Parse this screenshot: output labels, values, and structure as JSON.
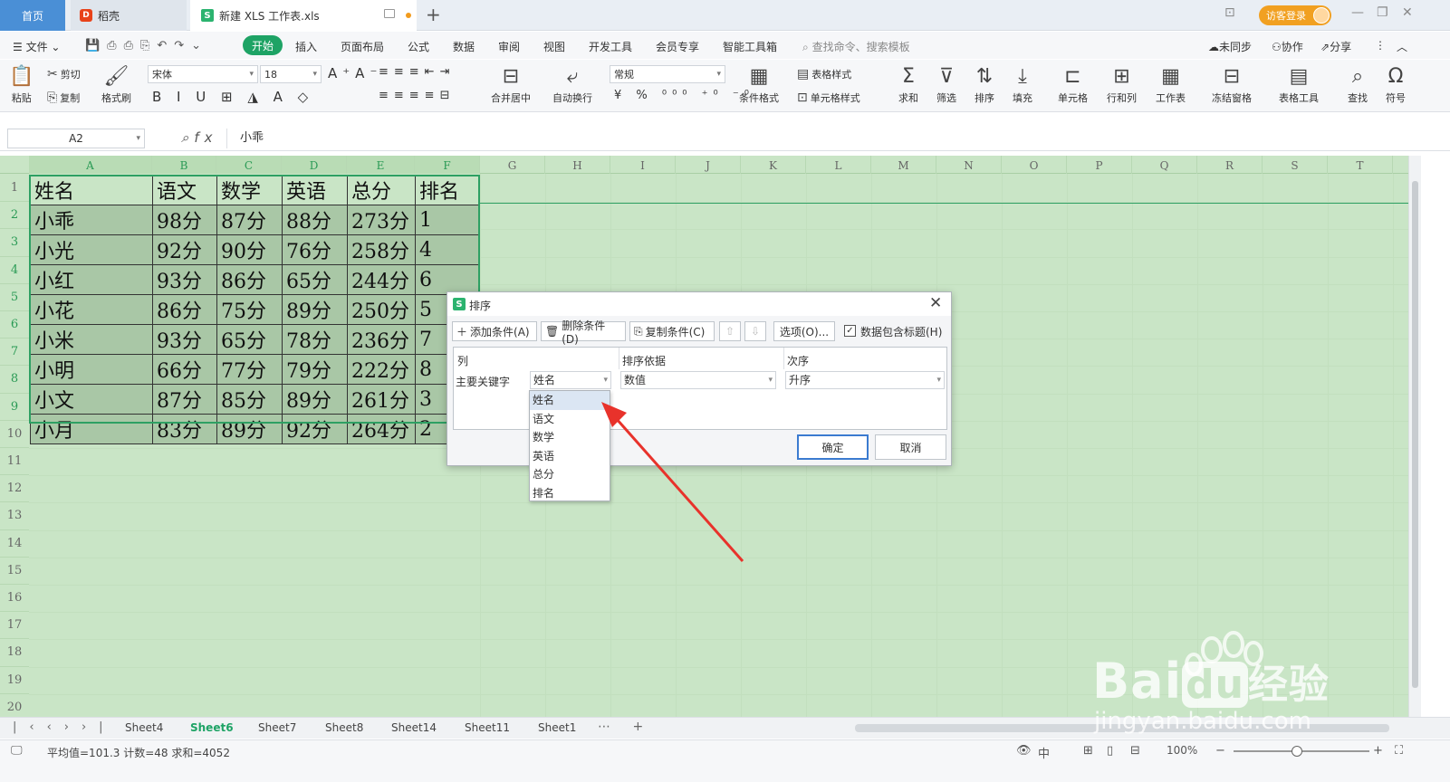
{
  "titlebar": {
    "tabs": [
      {
        "label": "首页"
      },
      {
        "label": "稻壳"
      },
      {
        "label": "新建 XLS 工作表.xls"
      }
    ],
    "visitor_label": "访客登录"
  },
  "menubar": {
    "file_label": "文件",
    "items": [
      "开始",
      "插入",
      "页面布局",
      "公式",
      "数据",
      "审阅",
      "视图",
      "开发工具",
      "会员专享",
      "智能工具箱"
    ],
    "search_placeholder": "查找命令、搜索模板",
    "sync_label": "未同步",
    "collab_label": "协作",
    "share_label": "分享"
  },
  "ribbon": {
    "paste": "粘贴",
    "cut": "剪切",
    "copy": "复制",
    "format_painter": "格式刷",
    "font_name": "宋体",
    "font_size": "18",
    "merge_center": "合并居中",
    "wrap_text": "自动换行",
    "number_format": "常规",
    "cond_format": "条件格式",
    "table_style": "表格样式",
    "cell_style": "单元格样式",
    "sum": "求和",
    "filter": "筛选",
    "sort": "排序",
    "fill": "填充",
    "cells": "单元格",
    "rows_cols": "行和列",
    "worksheet": "工作表",
    "freeze": "冻结窗格",
    "table_tools": "表格工具",
    "find": "查找",
    "symbol": "符号"
  },
  "formula": {
    "cell_ref": "A2",
    "fx": "fx",
    "value": "小乖"
  },
  "sheet": {
    "columns": [
      "A",
      "B",
      "C",
      "D",
      "E",
      "F",
      "G",
      "H",
      "I",
      "J",
      "K",
      "L",
      "M",
      "N",
      "O",
      "P",
      "Q",
      "R",
      "S",
      "T"
    ],
    "rows": [
      "1",
      "2",
      "3",
      "4",
      "5",
      "6",
      "7",
      "8",
      "9",
      "10",
      "11",
      "12",
      "13",
      "14",
      "15",
      "16",
      "17",
      "18",
      "19",
      "20"
    ],
    "header": [
      "姓名",
      "语文",
      "数学",
      "英语",
      "总分",
      "排名"
    ],
    "data": [
      [
        "小乖",
        "98分",
        "87分",
        "88分",
        "273分",
        "1"
      ],
      [
        "小光",
        "92分",
        "90分",
        "76分",
        "258分",
        "4"
      ],
      [
        "小红",
        "93分",
        "86分",
        "65分",
        "244分",
        "6"
      ],
      [
        "小花",
        "86分",
        "75分",
        "89分",
        "250分",
        "5"
      ],
      [
        "小米",
        "93分",
        "65分",
        "78分",
        "236分",
        "7"
      ],
      [
        "小明",
        "66分",
        "77分",
        "79分",
        "222分",
        "8"
      ],
      [
        "小文",
        "87分",
        "85分",
        "89分",
        "261分",
        "3"
      ],
      [
        "小月",
        "83分",
        "89分",
        "92分",
        "264分",
        "2"
      ]
    ]
  },
  "sheettabs": {
    "tabs": [
      "Sheet4",
      "Sheet6",
      "Sheet7",
      "Sheet8",
      "Sheet14",
      "Sheet11",
      "Sheet1"
    ],
    "active": "Sheet6"
  },
  "status": {
    "summary": "平均值=101.3  计数=48  求和=4052",
    "zoom": "100%"
  },
  "dialog": {
    "title": "排序",
    "add_condition": "添加条件(A)",
    "delete_condition": "删除条件(D)",
    "copy_condition": "复制条件(C)",
    "options": "选项(O)...",
    "has_header": "数据包含标题(H)",
    "col_header": "列",
    "basis_header": "排序依据",
    "order_header": "次序",
    "key_label": "主要关键字",
    "key_value": "姓名",
    "basis_value": "数值",
    "order_value": "升序",
    "dropdown_options": [
      "姓名",
      "语文",
      "数学",
      "英语",
      "总分",
      "排名"
    ],
    "ok": "确定",
    "cancel": "取消"
  },
  "watermark": {
    "brand": "Bai",
    "brand2": "du",
    "suffix": "经验",
    "url": "jingyan.baidu.com"
  },
  "colors": {
    "accent": "#1ea365",
    "sheet_bg": "#c9e5c6",
    "arrow": "#e8322b"
  }
}
